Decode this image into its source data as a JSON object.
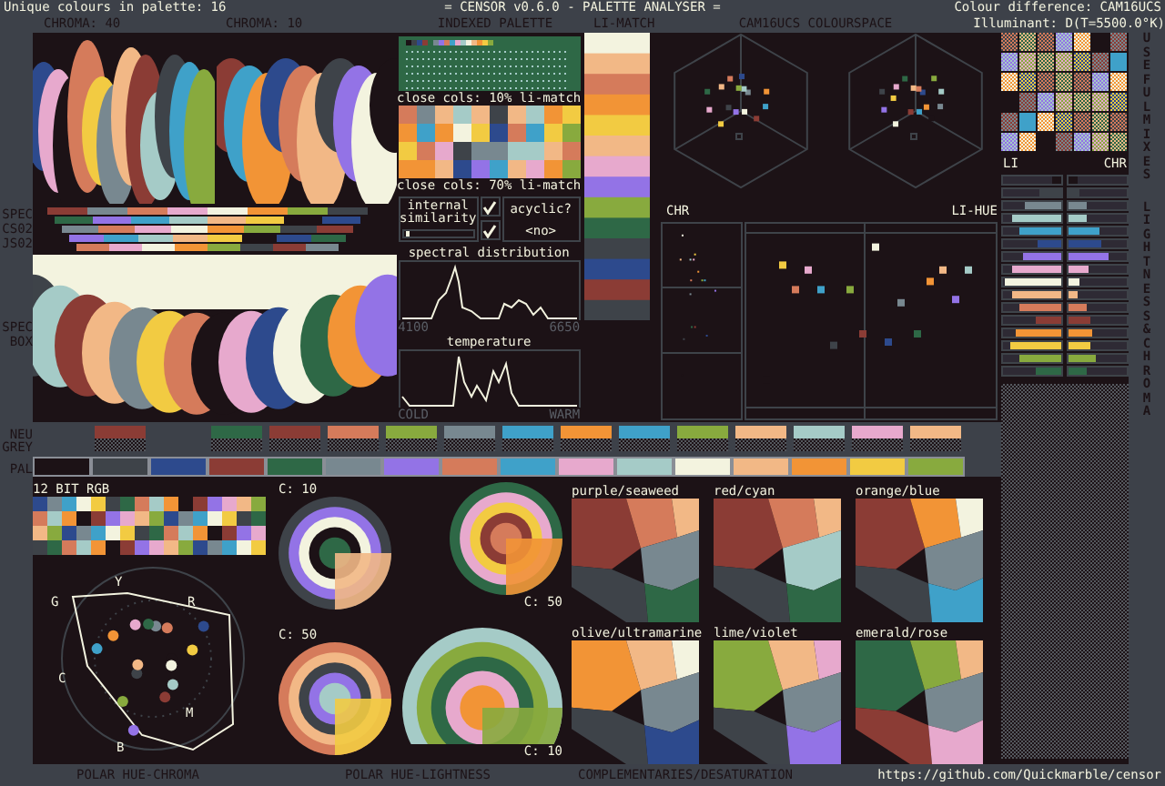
{
  "header": {
    "palette_count": "Unique colours in palette: 16",
    "title": "= CENSOR v0.6.0 - PALETTE ANALYSER =",
    "colour_difference": "Colour difference: CAM16UCS",
    "illuminant": "Illuminant: D(T=5500.0°K)"
  },
  "panel_labels": {
    "chroma_40": "CHROMA: 40",
    "chroma_10": "CHROMA: 10",
    "indexed_palette": "INDEXED PALETTE",
    "li_match": "LI-MATCH",
    "colourspace": "CAM16UCS COLOURSPACE"
  },
  "side_labels": {
    "spec_cs": [
      "SPEC",
      "CS02",
      "JS02"
    ],
    "spec_box": [
      "SPEC",
      "BOX"
    ],
    "neutral_grey": [
      "NEU",
      "GREY"
    ],
    "palette": [
      "PAL"
    ]
  },
  "palette": [
    {
      "color": "#1c1216"
    },
    {
      "color": "#3e4349",
      "neutral_match": {
        "color": "#8b3c35"
      }
    },
    {
      "color": "#2d4a8d"
    },
    {
      "color": "#8b3c35",
      "neutral_match": {
        "color": "#2e6846"
      }
    },
    {
      "color": "#2e6846",
      "neutral_match": {
        "color": "#8b3c35"
      }
    },
    {
      "color": "#788890",
      "neutral_match": {
        "color": "#d57b5b"
      }
    },
    {
      "color": "#9373e6",
      "neutral_match": {
        "color": "#88aa3e"
      }
    },
    {
      "color": "#d57b5b",
      "neutral_match": {
        "color": "#788890"
      }
    },
    {
      "color": "#3fa1c9",
      "neutral_match": {
        "color": "#3fa1c9"
      }
    },
    {
      "color": "#e7a9cd",
      "neutral_match": {
        "color": "#f29436"
      }
    },
    {
      "color": "#a5cbc7",
      "neutral_match": {
        "color": "#3fa1c9"
      }
    },
    {
      "color": "#f3f3df",
      "neutral_match": {
        "color": "#88aa3e"
      }
    },
    {
      "color": "#f2b886",
      "neutral_match": {
        "color": "#f2b886"
      }
    },
    {
      "color": "#f29436",
      "neutral_match": {
        "color": "#a5cbc7"
      }
    },
    {
      "color": "#f2cb42",
      "neutral_match": {
        "color": "#e7a9cd"
      }
    },
    {
      "color": "#88aa3e",
      "neutral_match": {
        "color": "#f2b886"
      }
    }
  ],
  "close_cols_10": {
    "label": "close cols: 10% li-match",
    "pairs": [
      {
        "swatches": [
          {
            "color": "#d57b5b"
          },
          {
            "color": "#f29436"
          }
        ]
      },
      {
        "swatches": [
          {
            "color": "#788890"
          },
          {
            "color": "#3fa1c9"
          }
        ]
      },
      {
        "swatches": [
          {
            "color": "#f2b886"
          },
          {
            "color": "#f29436"
          }
        ]
      },
      {
        "swatches": [
          {
            "color": "#a5cbc7"
          },
          {
            "color": "#f3f3df"
          }
        ]
      },
      {
        "swatches": [
          {
            "color": "#f2b886"
          },
          {
            "color": "#f2cb42"
          }
        ]
      },
      {
        "swatches": [
          {
            "color": "#3e4349"
          },
          {
            "color": "#2d4a8d"
          }
        ]
      },
      {
        "swatches": [
          {
            "color": "#f2b886"
          },
          {
            "color": "#d57b5b"
          }
        ]
      },
      {
        "swatches": [
          {
            "color": "#a5cbc7"
          },
          {
            "color": "#3fa1c9"
          }
        ]
      },
      {
        "swatches": [
          {
            "color": "#f29436"
          },
          {
            "color": "#f2cb42"
          }
        ]
      },
      {
        "swatches": [
          {
            "color": "#f2cb42"
          },
          {
            "color": "#88aa3e"
          }
        ]
      }
    ]
  },
  "close_cols_70": {
    "label": "close cols: 70% li-match",
    "pairs": [
      {
        "swatches": [
          {
            "color": "#f2cb42"
          },
          {
            "color": "#f29436"
          }
        ]
      },
      {
        "swatches": [
          {
            "color": "#d57b5b"
          },
          {
            "color": "#f29436"
          }
        ]
      },
      {
        "swatches": [
          {
            "color": "#e7a9cd"
          },
          {
            "color": "#f2b886"
          }
        ]
      },
      {
        "swatches": [
          {
            "color": "#3e4349"
          },
          {
            "color": "#2d4a8d"
          }
        ]
      },
      {
        "swatches": [
          {
            "color": "#788890"
          },
          {
            "color": "#9373e6"
          }
        ]
      },
      {
        "swatches": [
          {
            "color": "#788890"
          },
          {
            "color": "#3fa1c9"
          }
        ]
      },
      {
        "swatches": [
          {
            "color": "#a5cbc7"
          },
          {
            "color": "#f2b886"
          }
        ]
      },
      {
        "swatches": [
          {
            "color": "#a5cbc7"
          },
          {
            "color": "#e7a9cd"
          }
        ]
      },
      {
        "swatches": [
          {
            "color": "#f2b886"
          },
          {
            "color": "#f29436"
          }
        ]
      },
      {
        "swatches": [
          {
            "color": "#d57b5b"
          },
          {
            "color": "#88aa3e"
          }
        ]
      }
    ]
  },
  "internal_similarity": {
    "label": "internal similarity",
    "checked": true,
    "level": 0.03
  },
  "acyclic": {
    "label": "acyclic?",
    "value": "<no>",
    "checked": true
  },
  "spectral": {
    "label": "spectral distribution",
    "min": "4100",
    "max": "6650"
  },
  "temperature": {
    "label": "temperature",
    "min": "COLD",
    "max": "WARM"
  },
  "scatter_labels": {
    "chroma": "CHR",
    "lightness_hue": "LI-HUE"
  },
  "bar_labels": {
    "lightness": "LI",
    "chroma": "CHR"
  },
  "lightness_chroma": [
    {
      "color": "#1c1216",
      "lightness": {
        "level": 0.17
      },
      "chroma": {
        "level": 0.17
      }
    },
    {
      "color": "#3e4349",
      "lightness": {
        "level": 0.38
      },
      "chroma": {
        "level": 0.2
      }
    },
    {
      "color": "#788890",
      "lightness": {
        "level": 0.64
      },
      "chroma": {
        "level": 0.3
      }
    },
    {
      "color": "#a5cbc7",
      "lightness": {
        "level": 0.84
      },
      "chroma": {
        "level": 0.3
      }
    },
    {
      "color": "#3fa1c9",
      "lightness": {
        "level": 0.72
      },
      "chroma": {
        "level": 0.52
      }
    },
    {
      "color": "#2d4a8d",
      "lightness": {
        "level": 0.4
      },
      "chroma": {
        "level": 0.55
      }
    },
    {
      "color": "#9373e6",
      "lightness": {
        "level": 0.66
      },
      "chroma": {
        "level": 0.68
      }
    },
    {
      "color": "#e7a9cd",
      "lightness": {
        "level": 0.84
      },
      "chroma": {
        "level": 0.35
      }
    },
    {
      "color": "#f3f3df",
      "lightness": {
        "level": 0.98
      },
      "chroma": {
        "level": 0.18
      }
    },
    {
      "color": "#f2b886",
      "lightness": {
        "level": 0.84
      },
      "chroma": {
        "level": 0.15
      }
    },
    {
      "color": "#d57b5b",
      "lightness": {
        "level": 0.72
      },
      "chroma": {
        "level": 0.31
      }
    },
    {
      "color": "#8b3c35",
      "lightness": {
        "level": 0.45
      },
      "chroma": {
        "level": 0.37
      }
    },
    {
      "color": "#f29436",
      "lightness": {
        "level": 0.77
      },
      "chroma": {
        "level": 0.42
      }
    },
    {
      "color": "#f2cb42",
      "lightness": {
        "level": 0.87
      },
      "chroma": {
        "level": 0.37
      }
    },
    {
      "color": "#88aa3e",
      "lightness": {
        "level": 0.72
      },
      "chroma": {
        "level": 0.48
      }
    },
    {
      "color": "#2e6846",
      "lightness": {
        "level": 0.45
      },
      "chroma": {
        "level": 0.32
      }
    }
  ],
  "side_titles": {
    "mixes": "USEFUL MIXES",
    "lightness_chroma": "LIGHTNESS & CHROMA"
  },
  "rgb_label": "12 BIT RGB",
  "hue_labels": [
    "G",
    "Y",
    "R",
    "C",
    "M",
    "B"
  ],
  "lightness_circles": [
    {
      "label": "C: 10"
    },
    {
      "label": "C: 50"
    },
    {
      "label": "C: 50"
    },
    {
      "label": "C: 10"
    }
  ],
  "complementaries": [
    {
      "title": "purple/seaweed"
    },
    {
      "title": "red/cyan"
    },
    {
      "title": "orange/blue"
    },
    {
      "title": "olive/ultramarine"
    },
    {
      "title": "lime/violet"
    },
    {
      "title": "emerald/rose"
    }
  ],
  "footer": {
    "polar_chroma": "POLAR HUE-CHROMA",
    "polar_lightness": "POLAR HUE-LIGHTNESS",
    "complementaries": "COMPLEMENTARIES/DESATURATION",
    "link": "https://github.com/Quickmarble/censor"
  }
}
